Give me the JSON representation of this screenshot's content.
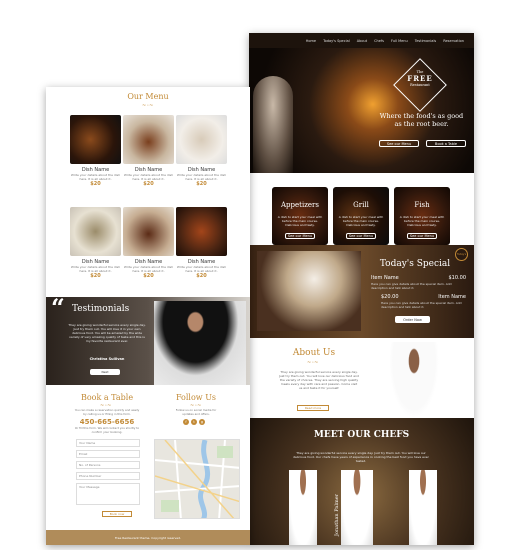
{
  "nav": {
    "items": [
      "Home",
      "Today's Special",
      "About",
      "Chefs",
      "Full Menu",
      "Testimonials",
      "Reservation"
    ]
  },
  "hero": {
    "logo_top": "The",
    "logo_main": "FREE",
    "logo_sub": "Restaurant",
    "tagline_line1": "Where the food's as good",
    "tagline_line2": "as the root beer.",
    "btn_menu": "See our Menu",
    "btn_table": "Book a Table"
  },
  "categories": [
    {
      "title": "Appetizers",
      "desc": "A dish to start your meal with before the main course. Delicious and tasty.",
      "btn": "See our Menu"
    },
    {
      "title": "Grill",
      "desc": "A dish to start your meal with before the main course. Delicious and tasty.",
      "btn": "See our Menu"
    },
    {
      "title": "Fish",
      "desc": "A dish to start your meal with before the main course. Delicious and tasty.",
      "btn": "See our Menu"
    }
  ],
  "our_menu": {
    "title": "Our Menu",
    "dishes": [
      {
        "name": "Dish Name",
        "desc": "Write your details about the dish here. It is all about it.",
        "price": "$20"
      },
      {
        "name": "Dish Name",
        "desc": "Write your details about the dish here. It is all about it.",
        "price": "$20"
      },
      {
        "name": "Dish Name",
        "desc": "Write your details about the dish here. It is all about it.",
        "price": "$20"
      },
      {
        "name": "Dish Name",
        "desc": "Write your details about the dish here. It is all about it.",
        "price": "$20"
      },
      {
        "name": "Dish Name",
        "desc": "Write your details about the dish here. It is all about it.",
        "price": "$20"
      },
      {
        "name": "Dish Name",
        "desc": "Write your details about the dish here. It is all about it.",
        "price": "$20"
      }
    ]
  },
  "special": {
    "title": "Today's Special",
    "item1_name": "Item Name",
    "item1_price": "$10.00",
    "item1_desc": "Here you can give details about the special item. Add description and talk about it.",
    "item2_name": "Item Name",
    "item2_price": "$20.00",
    "item2_desc": "Here you can give details about the special item. Add description and talk about it.",
    "btn": "Order Now",
    "badge": "Today's"
  },
  "testimonials": {
    "title": "Testimonials",
    "text": "They are giving wonderful service every single day. Just try them out. You will love it in your own delicious food. You will be amazed by the wide variety of very amazing quality of taste and this is my favorite restaurant ever.",
    "author": "Christina Sullivan",
    "btn": "Next"
  },
  "about": {
    "title": "About Us",
    "text": "They are giving wonderful service every single day. Just try them out. You will love our delicious food and the variety of choices. They are serving high quality meals every day with care and passion. Come visit us and taste it for yourself.",
    "btn": "Read more"
  },
  "book": {
    "title": "Book a Table",
    "intro": "You can make a reservation quickly and easily by calling us or filling in this form.",
    "phone": "450-665-6656",
    "note": "Or fill this form. We will contact you shortly to confirm your booking.",
    "fields": [
      "Your Name",
      "Email",
      "No. of Persons",
      "Phone Number",
      "Your Message"
    ],
    "btn": "Book now"
  },
  "follow": {
    "title": "Follow Us",
    "intro": "Follow us on social media for updates and offers."
  },
  "chefs": {
    "title": "MEET OUR CHEFS",
    "text": "They are giving wonderful service every single day. Just try them out. You will love our delicious food. Our chefs have years of experience in cooking the best food you have ever tasted.",
    "name": "Jonathan Palmer"
  },
  "footer": {
    "text": "Free Restaurant theme. Copyright reserved."
  },
  "colors": {
    "gold": "#c28a36",
    "dark": "#2a1a10"
  }
}
